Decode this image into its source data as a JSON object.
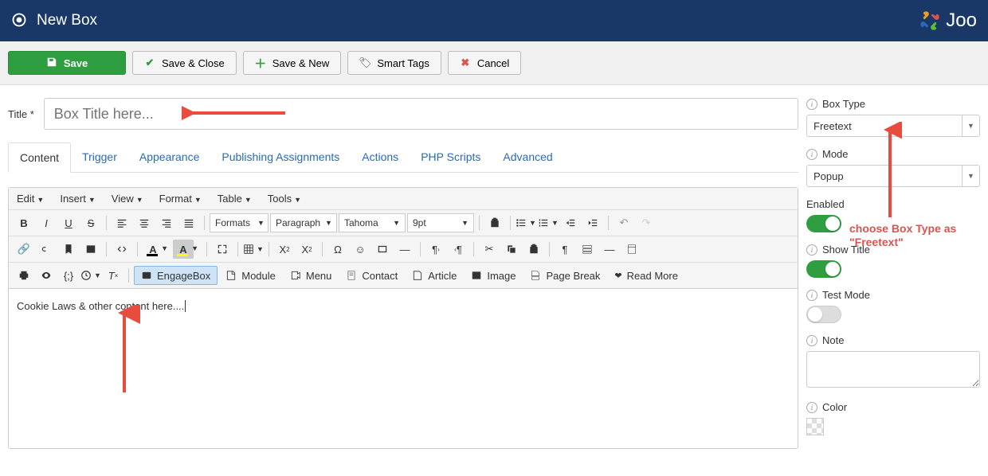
{
  "header": {
    "title": "New Box",
    "brand": "Joo"
  },
  "toolbar": {
    "save": "Save",
    "save_close": "Save & Close",
    "save_new": "Save & New",
    "smart_tags": "Smart Tags",
    "cancel": "Cancel"
  },
  "title_field": {
    "label": "Title *",
    "placeholder": "Box Title here..."
  },
  "tabs": [
    "Content",
    "Trigger",
    "Appearance",
    "Publishing Assignments",
    "Actions",
    "PHP Scripts",
    "Advanced"
  ],
  "active_tab": 0,
  "editor": {
    "menubar": [
      "Edit",
      "Insert",
      "View",
      "Format",
      "Table",
      "Tools"
    ],
    "selects": {
      "formats": "Formats",
      "paragraph": "Paragraph",
      "font": "Tahoma",
      "size": "9pt"
    },
    "buttons": {
      "engagebox": "EngageBox",
      "module": "Module",
      "menu": "Menu",
      "contact": "Contact",
      "article": "Article",
      "image": "Image",
      "page_break": "Page Break",
      "read_more": "Read More"
    },
    "body_text": "Cookie Laws & other content here...."
  },
  "sidebar": {
    "box_type": {
      "label": "Box Type",
      "value": "Freetext"
    },
    "mode": {
      "label": "Mode",
      "value": "Popup"
    },
    "enabled": {
      "label": "Enabled",
      "value": true
    },
    "show_title": {
      "label": "Show Title",
      "value": true
    },
    "test_mode": {
      "label": "Test Mode",
      "value": false
    },
    "note": {
      "label": "Note",
      "value": ""
    },
    "color": {
      "label": "Color"
    }
  },
  "annotations": {
    "box_type_hint": "choose Box Type as \"Freetext\""
  }
}
